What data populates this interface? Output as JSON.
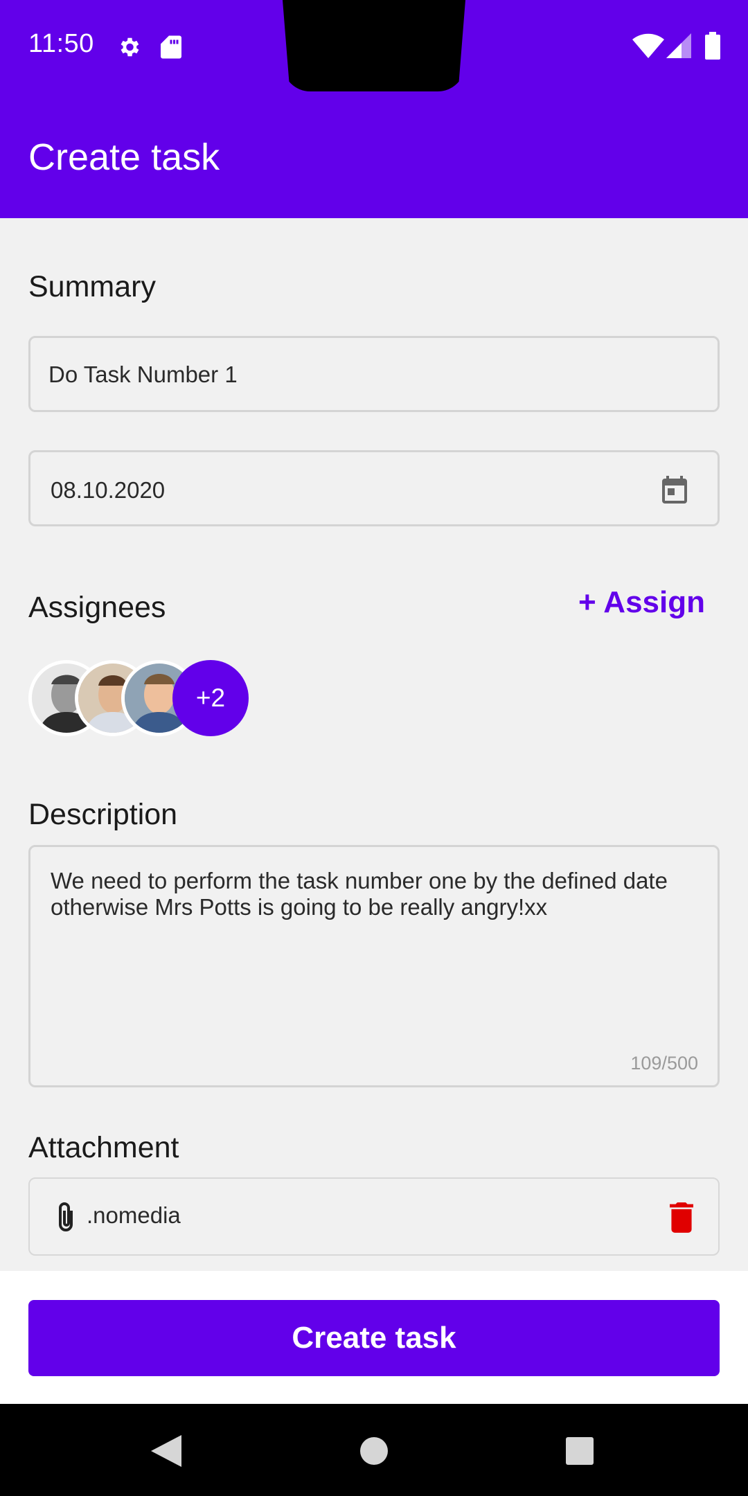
{
  "status_bar": {
    "time": "11:50"
  },
  "app_bar": {
    "title": "Create task"
  },
  "summary": {
    "label": "Summary",
    "value": "Do Task Number 1"
  },
  "date": {
    "value": "08.10.2020"
  },
  "assignees": {
    "label": "Assignees",
    "assign_link": "+ Assign",
    "more_count": "+2"
  },
  "description": {
    "label": "Description",
    "value": "We need to perform the task number one by the defined date otherwise Mrs Potts is going to be really angry!xx",
    "counter": "109/500"
  },
  "attachment": {
    "label": "Attachment",
    "file_name": ".nomedia"
  },
  "actions": {
    "create_label": "Create task"
  },
  "colors": {
    "primary": "#6200ea",
    "delete": "#e00000",
    "background": "#f1f1f1"
  },
  "icons": [
    "settings-icon",
    "sd-card-icon",
    "wifi-icon",
    "signal-icon",
    "battery-icon",
    "calendar-icon",
    "paperclip-icon",
    "trash-icon",
    "back-icon",
    "home-icon",
    "recents-icon"
  ]
}
